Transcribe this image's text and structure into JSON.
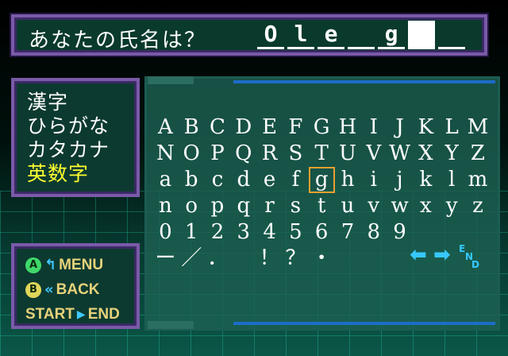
{
  "name_entry": {
    "prompt": "あなたの氏名は？",
    "slots": [
      "O",
      "l",
      "e",
      "",
      "g",
      "",
      ""
    ],
    "cursor_index": 5
  },
  "mode_menu": {
    "items": [
      {
        "label": "漢字",
        "active": false
      },
      {
        "label": "ひらがな",
        "active": false
      },
      {
        "label": "カタカナ",
        "active": false
      },
      {
        "label": "英数字",
        "active": true
      }
    ]
  },
  "buttons": {
    "a_key": "A",
    "a_label": "MENU",
    "b_key": "B",
    "b_label": "BACK",
    "start_key": "START",
    "start_label": "END"
  },
  "char_grid": {
    "rows": [
      [
        "A",
        "B",
        "C",
        "D",
        "E",
        "F",
        "G",
        "H",
        "I",
        "J",
        "K",
        "L",
        "M"
      ],
      [
        "N",
        "O",
        "P",
        "Q",
        "R",
        "S",
        "T",
        "U",
        "V",
        "W",
        "X",
        "Y",
        "Z"
      ],
      [
        "a",
        "b",
        "c",
        "d",
        "e",
        "f",
        "g",
        "h",
        "i",
        "j",
        "k",
        "l",
        "m"
      ],
      [
        "n",
        "o",
        "p",
        "q",
        "r",
        "s",
        "t",
        "u",
        "v",
        "w",
        "x",
        "y",
        "z"
      ],
      [
        "0",
        "1",
        "2",
        "3",
        "4",
        "5",
        "6",
        "7",
        "8",
        "9",
        "",
        "",
        ""
      ],
      [
        "ー",
        "／",
        "．",
        "",
        "！",
        "？",
        "・",
        "",
        "",
        "",
        "",
        "",
        ""
      ]
    ],
    "selected_row": 2,
    "selected_col": 6
  },
  "nav": {
    "left": "⬅",
    "right": "➡",
    "end_top": "E",
    "end_mid": "N",
    "end_bot": "D"
  },
  "colors": {
    "frame": "#7a5aa8",
    "panel": "#1c6052",
    "active_text": "#ffff30",
    "arrow": "#36c8ff",
    "selector": "#e8a030"
  }
}
